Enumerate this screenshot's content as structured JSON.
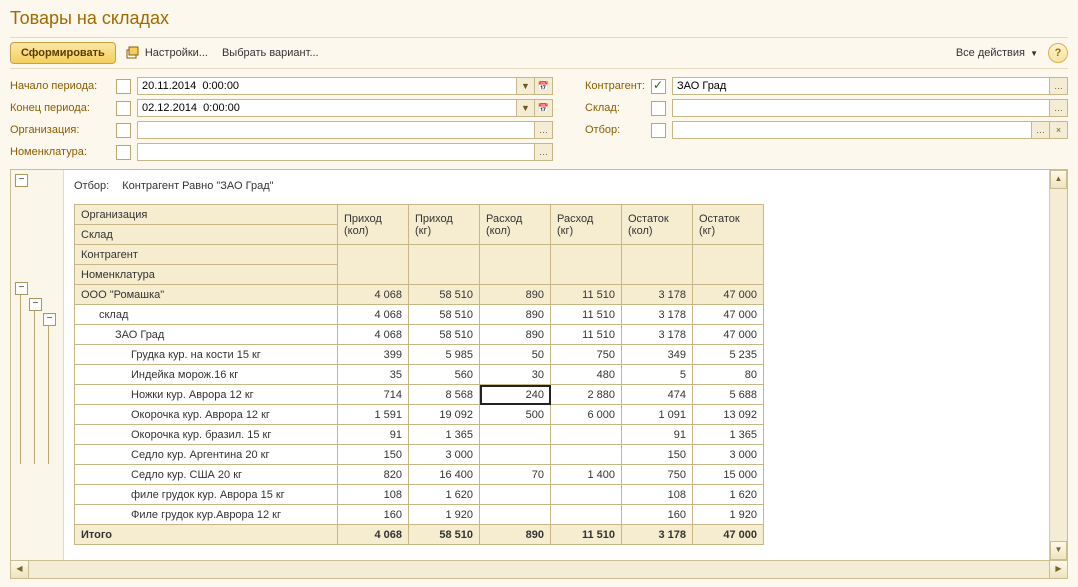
{
  "title": "Товары на складах",
  "toolbar": {
    "form": "Сформировать",
    "settings": "Настройки...",
    "variant": "Выбрать вариант...",
    "all_actions": "Все действия"
  },
  "filters": {
    "period_start": {
      "label": "Начало периода:",
      "value": "20.11.2014  0:00:00",
      "checked": false
    },
    "period_end": {
      "label": "Конец периода:",
      "value": "02.12.2014  0:00:00",
      "checked": false
    },
    "org": {
      "label": "Организация:",
      "value": "",
      "checked": false
    },
    "nom": {
      "label": "Номенклатура:",
      "value": "",
      "checked": false
    },
    "contragent": {
      "label": "Контрагент:",
      "value": "ЗАО Град",
      "checked": true
    },
    "sklad": {
      "label": "Склад:",
      "value": "",
      "checked": false
    },
    "otbor": {
      "label": "Отбор:",
      "value": "",
      "checked": false
    }
  },
  "report": {
    "filter_label": "Отбор:",
    "filter_text": "Контрагент Равно \"ЗАО Град\"",
    "group_headers": [
      "Организация",
      "Склад",
      "Контрагент",
      "Номенклатура"
    ],
    "cols": [
      {
        "h1": "Приход",
        "h2": "(кол)"
      },
      {
        "h1": "Приход",
        "h2": "(кг)"
      },
      {
        "h1": "Расход",
        "h2": "(кол)"
      },
      {
        "h1": "Расход",
        "h2": "(кг)"
      },
      {
        "h1": "Остаток",
        "h2": "(кол)"
      },
      {
        "h1": "Остаток",
        "h2": "(кг)"
      }
    ],
    "rows": [
      {
        "lvl": 0,
        "name": "ООО \"Ромашка\"",
        "v": [
          "4 068",
          "58 510",
          "890",
          "11 510",
          "3 178",
          "47 000"
        ]
      },
      {
        "lvl": 1,
        "name": "склад",
        "v": [
          "4 068",
          "58 510",
          "890",
          "11 510",
          "3 178",
          "47 000"
        ]
      },
      {
        "lvl": 2,
        "name": "ЗАО Град",
        "v": [
          "4 068",
          "58 510",
          "890",
          "11 510",
          "3 178",
          "47 000"
        ]
      },
      {
        "lvl": 3,
        "name": "Грудка кур. на кости 15 кг",
        "v": [
          "399",
          "5 985",
          "50",
          "750",
          "349",
          "5 235"
        ]
      },
      {
        "lvl": 3,
        "name": "Индейка морож.16 кг",
        "v": [
          "35",
          "560",
          "30",
          "480",
          "5",
          "80"
        ]
      },
      {
        "lvl": 3,
        "name": "Ножки кур. Аврора 12 кг",
        "v": [
          "714",
          "8 568",
          "240",
          "2 880",
          "474",
          "5 688"
        ],
        "sel": 2
      },
      {
        "lvl": 3,
        "name": "Окорочка кур. Аврора 12 кг",
        "v": [
          "1 591",
          "19 092",
          "500",
          "6 000",
          "1 091",
          "13 092"
        ]
      },
      {
        "lvl": 3,
        "name": "Окорочка кур. бразил. 15 кг",
        "v": [
          "91",
          "1 365",
          "",
          "",
          "91",
          "1 365"
        ]
      },
      {
        "lvl": 3,
        "name": "Седло кур. Аргентина 20 кг",
        "v": [
          "150",
          "3 000",
          "",
          "",
          "150",
          "3 000"
        ]
      },
      {
        "lvl": 3,
        "name": "Седло кур. США 20 кг",
        "v": [
          "820",
          "16 400",
          "70",
          "1 400",
          "750",
          "15 000"
        ]
      },
      {
        "lvl": 3,
        "name": "филе грудок кур. Аврора 15 кг",
        "v": [
          "108",
          "1 620",
          "",
          "",
          "108",
          "1 620"
        ]
      },
      {
        "lvl": 3,
        "name": "Филе грудок кур.Аврора 12 кг",
        "v": [
          "160",
          "1 920",
          "",
          "",
          "160",
          "1 920"
        ]
      }
    ],
    "total": {
      "label": "Итого",
      "v": [
        "4 068",
        "58 510",
        "890",
        "11 510",
        "3 178",
        "47 000"
      ]
    }
  }
}
